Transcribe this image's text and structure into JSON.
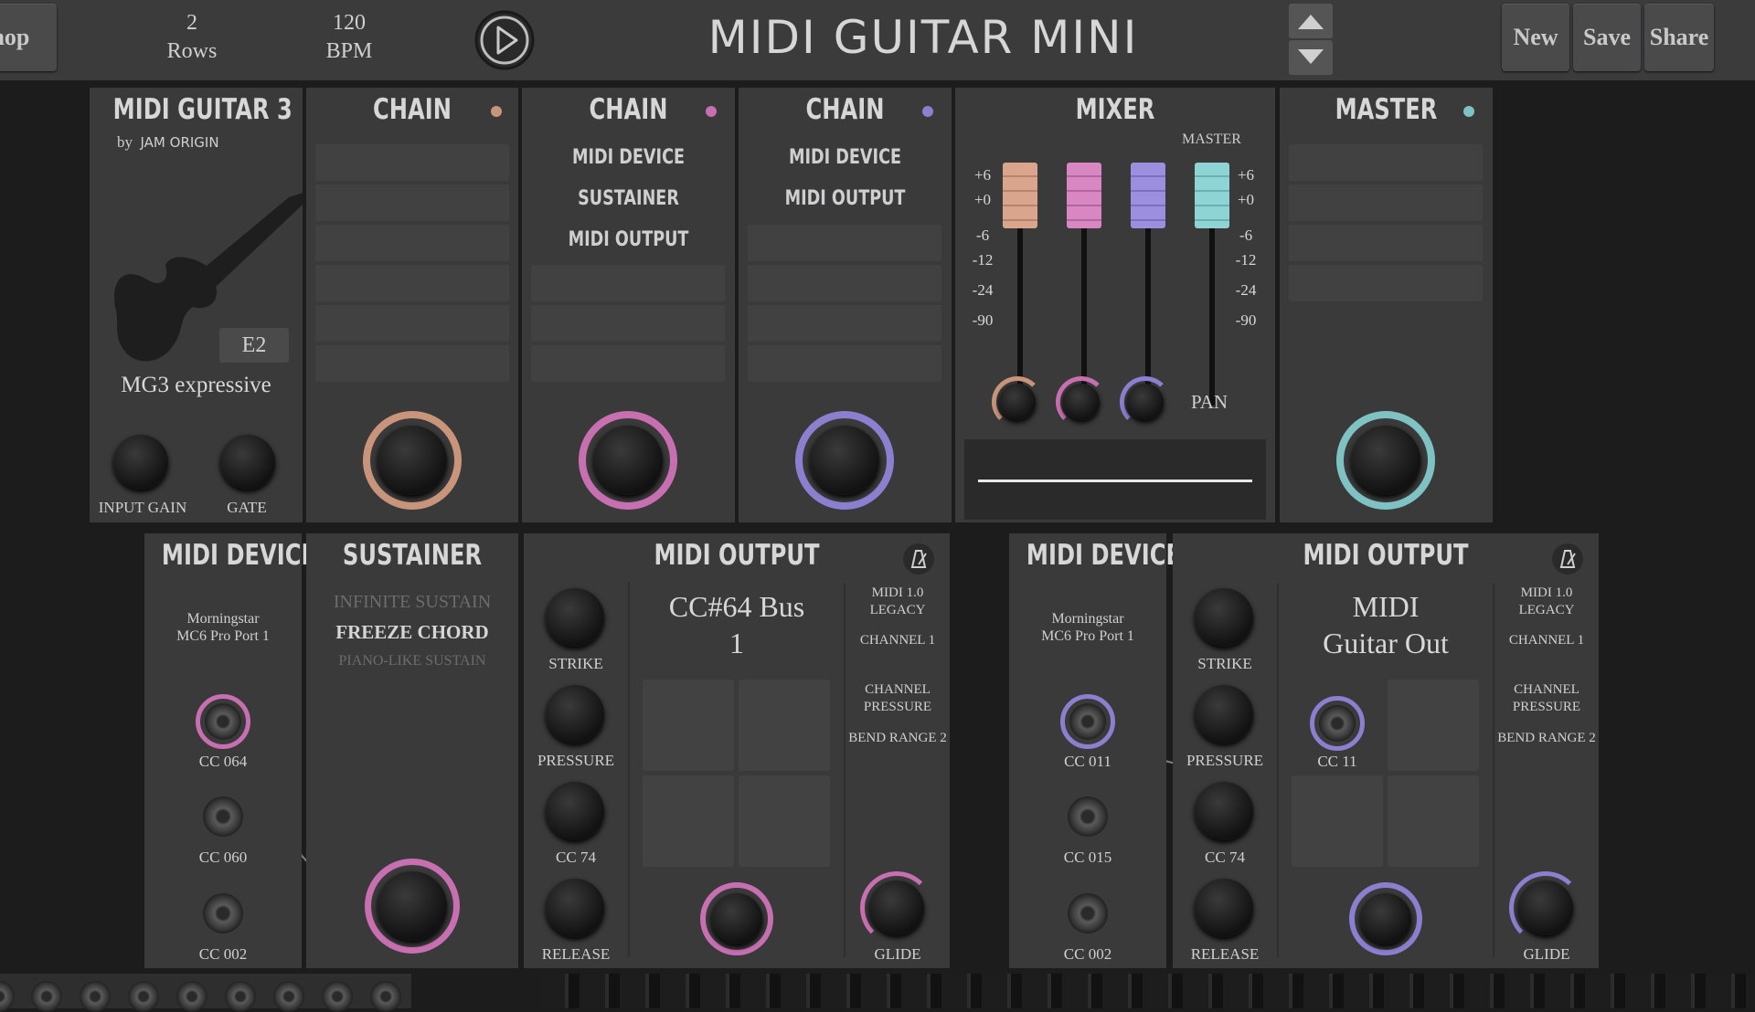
{
  "header": {
    "shop_label": "Shop",
    "rows_value": "2",
    "rows_label": "Rows",
    "bpm_value": "120",
    "bpm_label": "BPM",
    "app_title": "MIDI GUITAR MINI",
    "new_label": "New",
    "save_label": "Save",
    "share_label": "Share"
  },
  "row1": {
    "guitar": {
      "title": "MIDI GUITAR 3",
      "by": "by",
      "maker": "JAM ORIGIN",
      "note": "E2",
      "preset": "MG3 expressive",
      "input_gain_label": "INPUT GAIN",
      "gate_label": "GATE"
    },
    "chain1": {
      "title": "CHAIN",
      "color": "#c9957a",
      "items": []
    },
    "chain2": {
      "title": "CHAIN",
      "color": "#c86fb1",
      "items": [
        "MIDI DEVICE",
        "SUSTAINER",
        "MIDI OUTPUT"
      ]
    },
    "chain3": {
      "title": "CHAIN",
      "color": "#8b7fd0",
      "items": [
        "MIDI DEVICE",
        "MIDI OUTPUT"
      ]
    },
    "mixer": {
      "title": "MIXER",
      "master_label": "MASTER",
      "scale_left": [
        "+6",
        "+0",
        "-6",
        "-12",
        "-24",
        "-90"
      ],
      "scale_right": [
        "+6",
        "+0",
        "-6",
        "-12",
        "-24",
        "-90"
      ],
      "pan_label": "PAN",
      "fader_colors": [
        "#d9a58c",
        "#d887c3",
        "#9d8fe0",
        "#8fd4d4"
      ]
    },
    "master": {
      "title": "MASTER",
      "color": "#7fc2c4"
    }
  },
  "row2": {
    "device1": {
      "title": "MIDI DEVICE",
      "port_line1": "Morningstar",
      "port_line2": "MC6 Pro Port 1",
      "cc_a": "CC 064",
      "cc_b": "CC 060",
      "cc_c": "CC 002"
    },
    "sustainer": {
      "title": "SUSTAINER",
      "opt1": "INFINITE SUSTAIN",
      "opt2": "FREEZE CHORD",
      "opt3": "PIANO-LIKE SUSTAIN"
    },
    "output1": {
      "title": "MIDI OUTPUT",
      "knob1": "STRIKE",
      "knob2": "PRESSURE",
      "knob3": "CC 74",
      "knob4": "RELEASE",
      "name_line1": "CC#64 Bus",
      "name_line2": "1",
      "opt_midi": "MIDI 1.0 LEGACY",
      "opt_channel": "CHANNEL 1",
      "opt_pressure": "CHANNEL PRESSURE",
      "opt_bend": "BEND RANGE 2",
      "glide": "GLIDE"
    },
    "device2": {
      "title": "MIDI DEVICE",
      "port_line1": "Morningstar",
      "port_line2": "MC6 Pro Port 1",
      "cc_a": "CC 011",
      "cc_b": "CC 015",
      "cc_c": "CC 002"
    },
    "output2": {
      "title": "MIDI OUTPUT",
      "knob1": "STRIKE",
      "knob2": "PRESSURE",
      "knob3": "CC 74",
      "knob4": "RELEASE",
      "name_line1": "MIDI",
      "name_line2": "Guitar Out",
      "cc_label": "CC 11",
      "opt_midi": "MIDI 1.0 LEGACY",
      "opt_channel": "CHANNEL 1",
      "opt_pressure": "CHANNEL PRESSURE",
      "opt_bend": "BEND RANGE 2",
      "glide": "GLIDE"
    }
  }
}
